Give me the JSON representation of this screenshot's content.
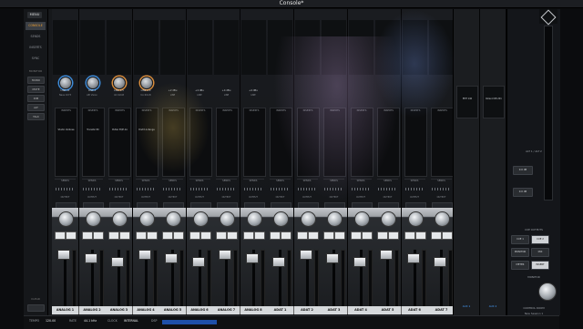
{
  "window": {
    "title": "Console*"
  },
  "sidebar": {
    "menu_label": "MENU",
    "tabs": [
      "CONSOLE",
      "SENDS",
      "INSERTS",
      "SYNC"
    ],
    "active_tab": "CONSOLE",
    "section_label": "MONITOR",
    "buttons": [
      "MONO",
      "MUTE",
      "DIM",
      "ALT",
      "TALK"
    ],
    "bottom_label": "CLEAR"
  },
  "top_bar": {
    "label": "Apollo"
  },
  "channels": [
    {
      "name": "ANALOG 1",
      "preamp_value": "LINE 12",
      "preamp_name": "Neve 1073",
      "insert": "Studio Verbose",
      "knob": "blue"
    },
    {
      "name": "ANALOG 2",
      "preamp_value": "LINE 4",
      "preamp_name": "API Vision",
      "insert": "Transfer 80",
      "knob": "blue"
    },
    {
      "name": "ANALOG 3",
      "preamp_value": "LINE 5.5",
      "preamp_name": "UA 610-B",
      "insert": "Pultec EQP-1A",
      "knob": "orange"
    },
    {
      "name": "ANALOG 4",
      "preamp_value": "LINE 2.0",
      "preamp_name": "UA 610-B",
      "insert": "Distrt & Range",
      "knob": "orange"
    },
    {
      "name": "ANALOG 5",
      "preamp_value": "+2 dBu",
      "preamp_name": "LINE",
      "insert": "",
      "knob": ""
    },
    {
      "name": "ANALOG 6",
      "preamp_value": "+4 dBu",
      "preamp_name": "LINE",
      "insert": "",
      "knob": ""
    },
    {
      "name": "ANALOG 7",
      "preamp_value": "+4 dBu",
      "preamp_name": "LINE",
      "insert": "",
      "knob": ""
    },
    {
      "name": "ANALOG 8",
      "preamp_value": "+4 dBu",
      "preamp_name": "LINE",
      "insert": "",
      "knob": ""
    },
    {
      "name": "ADAT 1",
      "preamp_value": "",
      "preamp_name": "",
      "insert": "",
      "knob": ""
    },
    {
      "name": "ADAT 2",
      "preamp_value": "",
      "preamp_name": "",
      "insert": "",
      "knob": ""
    },
    {
      "name": "ADAT 3",
      "preamp_value": "",
      "preamp_name": "",
      "insert": "",
      "knob": ""
    },
    {
      "name": "ADAT 4",
      "preamp_value": "",
      "preamp_name": "",
      "insert": "",
      "knob": ""
    },
    {
      "name": "ADAT 5",
      "preamp_value": "",
      "preamp_name": "",
      "insert": "",
      "knob": ""
    },
    {
      "name": "ADAT 6",
      "preamp_value": "",
      "preamp_name": "",
      "insert": "",
      "knob": ""
    },
    {
      "name": "ADAT 7",
      "preamp_value": "",
      "preamp_name": "",
      "insert": "",
      "knob": ""
    }
  ],
  "strip_labels": {
    "inserts": "INSERTS",
    "sends": "SENDS",
    "output": "OUTPUT"
  },
  "aux": [
    {
      "name": "AUX 1",
      "fx": "EMT 140"
    },
    {
      "name": "AUX 2",
      "fx": "Roland RE-201"
    }
  ],
  "right_panel": {
    "alt_label": "ALT 1 / ALT 2",
    "alt_values": [
      "0.0 dB",
      "0.0 dB"
    ],
    "cue_label": "CUE OUTPUTS",
    "monitor_label": "MONITOR",
    "control_label": "CONTROL ROOM",
    "buttons": [
      "CUE 1",
      "CUE 2",
      "MONITOR",
      "MIX",
      "METER",
      "INSERT"
    ],
    "session_label": "SESSIONS",
    "session_name": "New Session 1"
  },
  "statusbar": {
    "items": [
      {
        "label": "TEMPO",
        "value": "120.00"
      },
      {
        "label": "RATE",
        "value": "44.1 kHz"
      },
      {
        "label": "CLOCK",
        "value": "INTERNAL"
      },
      {
        "label": "DSP",
        "value": ""
      }
    ]
  }
}
